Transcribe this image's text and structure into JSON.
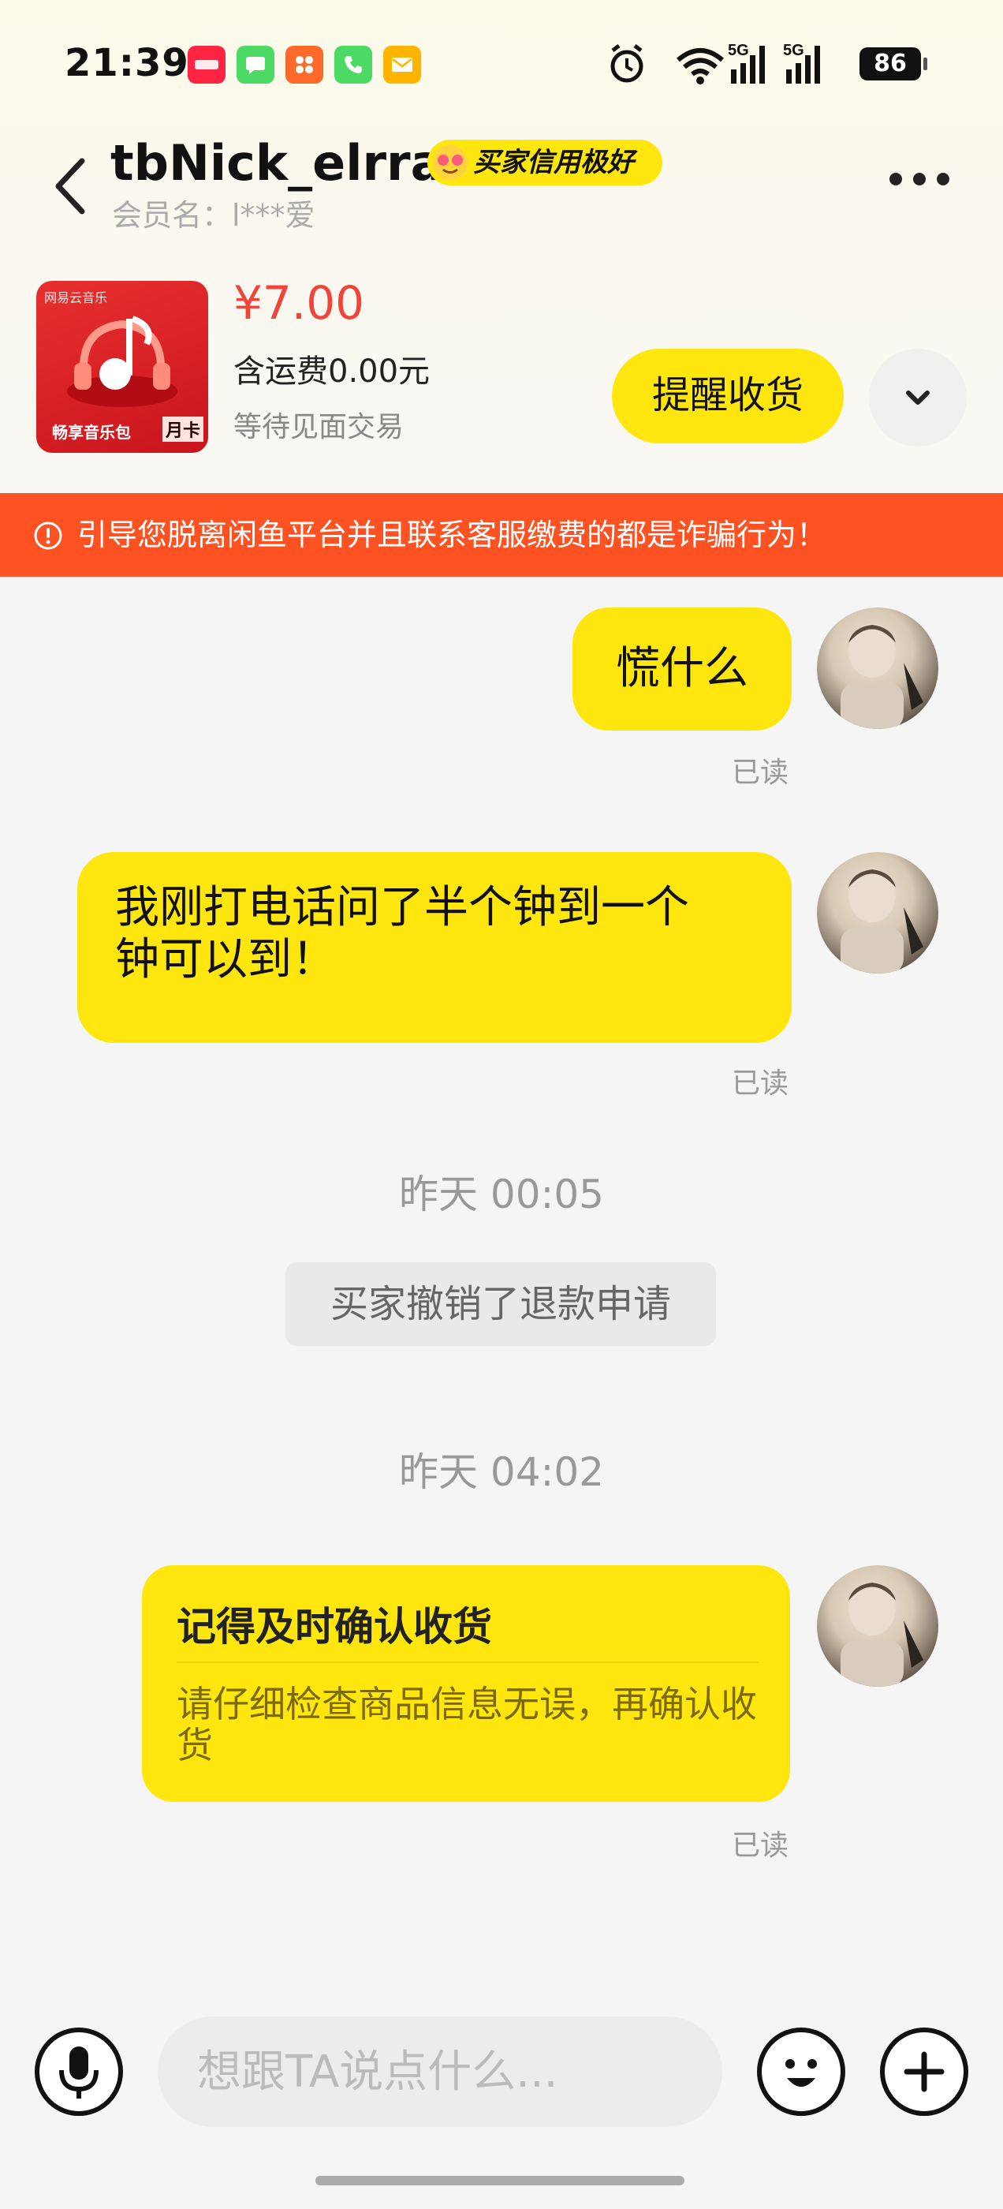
{
  "status_bar": {
    "time": "21:39",
    "battery": "86",
    "app_icons": [
      "xiaohongshu-icon",
      "messages-icon",
      "app-store-icon",
      "phone-icon",
      "mail-icon"
    ],
    "signal": [
      "5G",
      "5G"
    ]
  },
  "header": {
    "nickname": "tbNick_elrra",
    "credit_badge": "买家信用极好",
    "member_label": "会员名：l***爱"
  },
  "product": {
    "thumb_tag": "网易云音乐",
    "thumb_title": "畅享音乐包",
    "thumb_badge": "月卡",
    "price": "¥7.00",
    "shipping": "含运费0.00元",
    "status": "等待见面交易",
    "remind_button": "提醒收货"
  },
  "warning": {
    "text": "引导您脱离闲鱼平台并且联系客服缴费的都是诈骗行为！"
  },
  "messages": [
    {
      "text": "慌什么",
      "read": "已读"
    },
    {
      "text_line1": "我刚打电话问了半个钟到一个",
      "text_line2": "钟可以到！",
      "read": "已读"
    }
  ],
  "timeline": [
    {
      "time": "昨天 00:05",
      "notice": "买家撤销了退款申请"
    },
    {
      "time": "昨天 04:02"
    }
  ],
  "reminder_card": {
    "title": "记得及时确认收货",
    "body": "请仔细检查商品信息无误，再确认收货",
    "read": "已读"
  },
  "input": {
    "placeholder": "想跟TA说点什么..."
  },
  "colors": {
    "accent_yellow": "#ffe60f",
    "warning_orange": "#ff5222",
    "price_red": "#f0453a"
  }
}
